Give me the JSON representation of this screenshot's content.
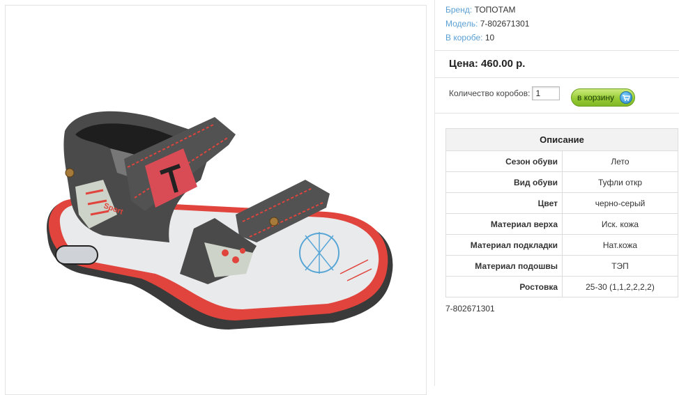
{
  "product": {
    "brand_label": "Бренд:",
    "brand": "ТОПОТАМ",
    "model_label": "Модель:",
    "model": "7-802671301",
    "box_label": "В коробе:",
    "box_count": "10",
    "price": "Цена: 460.00 р.",
    "quantity_label": "Количество коробов:",
    "quantity_value": "1",
    "cart_button": "в корзину",
    "sku_footer": "7-802671301"
  },
  "image": {
    "icon": "sandal-product-photo"
  },
  "description": {
    "header": "Описание",
    "rows": [
      {
        "key": "Сезон обуви",
        "value": "Лето"
      },
      {
        "key": "Вид обуви",
        "value": "Туфли откр"
      },
      {
        "key": "Цвет",
        "value": "черно-серый"
      },
      {
        "key": "Материал верха",
        "value": "Иск. кожа"
      },
      {
        "key": "Материал подкладки",
        "value": "Нат.кожа"
      },
      {
        "key": "Материал подошвы",
        "value": "ТЭП"
      },
      {
        "key": "Ростовка",
        "value": "25-30 (1,1,2,2,2,2)"
      }
    ]
  },
  "colors": {
    "label_blue": "#5a9fd4",
    "button_green": "#97cc36",
    "sandal_grey": "#4a4a4a",
    "sandal_red": "#d9443f"
  }
}
